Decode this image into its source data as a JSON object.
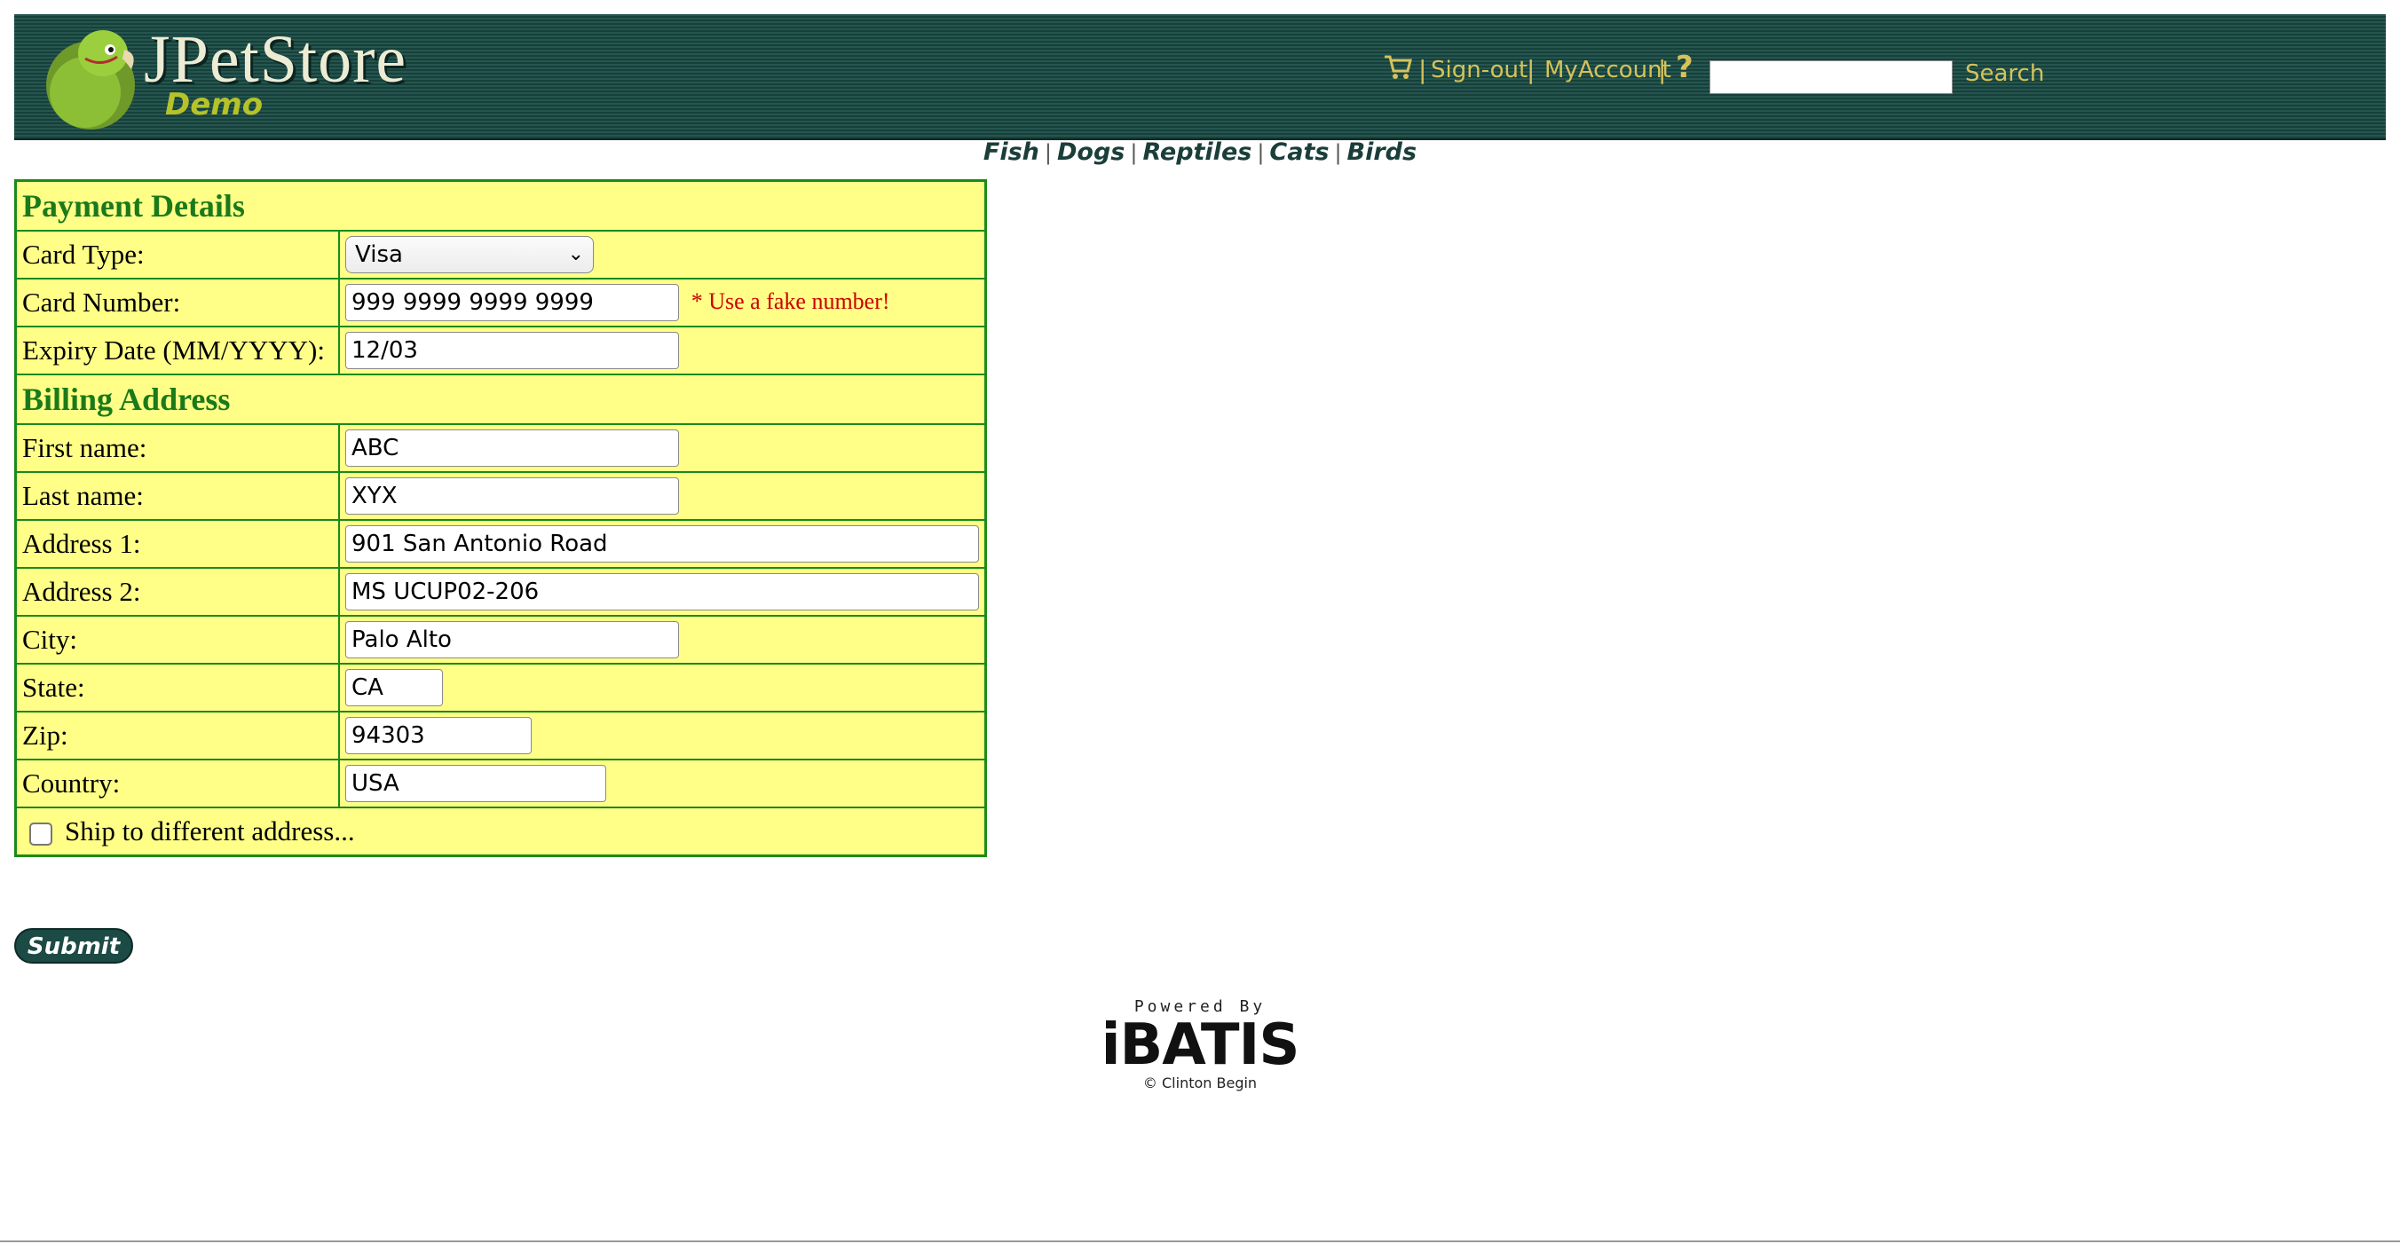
{
  "header": {
    "logo_title": "JPetStore",
    "logo_subtitle": "Demo",
    "signout_label": "Sign-out",
    "myaccount_label": "MyAccount",
    "help_label": "?",
    "search_value": "",
    "search_button_label": "Search"
  },
  "categories": [
    "Fish",
    "Dogs",
    "Reptiles",
    "Cats",
    "Birds"
  ],
  "payment": {
    "heading": "Payment Details",
    "card_type_label": "Card Type:",
    "card_type_value": "Visa",
    "card_number_label": "Card Number:",
    "card_number_value": "999 9999 9999 9999",
    "card_number_note": "* Use a fake number!",
    "expiry_label": "Expiry Date (MM/YYYY):",
    "expiry_value": "12/03"
  },
  "billing": {
    "heading": "Billing Address",
    "first_name_label": "First name:",
    "first_name_value": "ABC",
    "last_name_label": "Last name:",
    "last_name_value": "XYX",
    "address1_label": "Address 1:",
    "address1_value": "901 San Antonio Road",
    "address2_label": "Address 2:",
    "address2_value": "MS UCUP02-206",
    "city_label": "City:",
    "city_value": "Palo Alto",
    "state_label": "State:",
    "state_value": "CA",
    "zip_label": "Zip:",
    "zip_value": "94303",
    "country_label": "Country:",
    "country_value": "USA",
    "ship_label": "Ship to different address...",
    "ship_checked": false
  },
  "submit_label": "Submit",
  "powered_by": {
    "top": "Powered By",
    "logo": "iBATIS",
    "copyright": "© Clinton Begin"
  },
  "colors": {
    "header_bg": "#1c4a44",
    "header_link": "#d6c25a",
    "form_bg": "#ffff88",
    "form_border": "#1b8a1b",
    "heading_green": "#1a7a1a",
    "note_red": "#cc0000"
  }
}
